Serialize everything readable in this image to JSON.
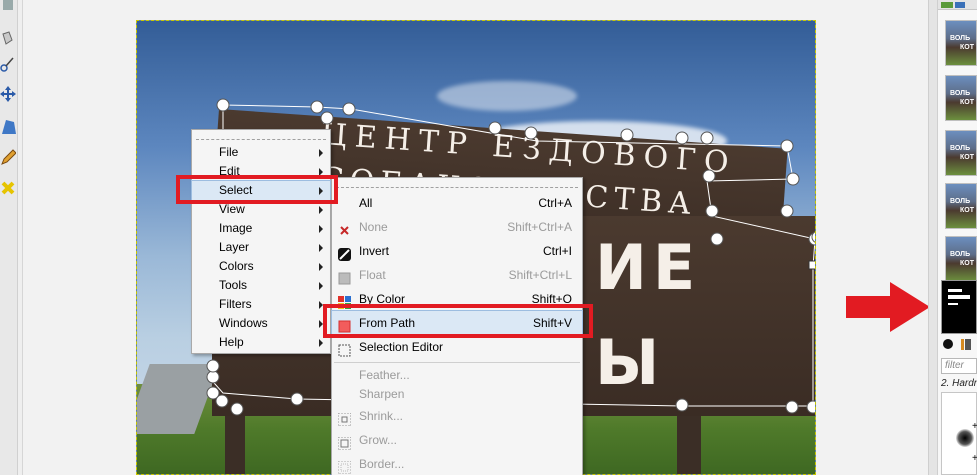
{
  "main_menu": {
    "items": [
      {
        "label": "File",
        "submenu": true
      },
      {
        "label": "Edit",
        "submenu": true
      },
      {
        "label": "Select",
        "submenu": true
      },
      {
        "label": "View",
        "submenu": true
      },
      {
        "label": "Image",
        "submenu": true
      },
      {
        "label": "Layer",
        "submenu": true
      },
      {
        "label": "Colors",
        "submenu": true
      },
      {
        "label": "Tools",
        "submenu": true
      },
      {
        "label": "Filters",
        "submenu": true
      },
      {
        "label": "Windows",
        "submenu": true
      },
      {
        "label": "Help",
        "submenu": true
      }
    ],
    "highlighted": "Select"
  },
  "select_menu": {
    "items": [
      {
        "label": "All",
        "shortcut": "Ctrl+A",
        "icon": "select-all-icon",
        "enabled": true
      },
      {
        "label": "None",
        "shortcut": "Shift+Ctrl+A",
        "icon": "select-none-icon",
        "enabled": false
      },
      {
        "label": "Invert",
        "shortcut": "Ctrl+I",
        "icon": "invert-icon",
        "enabled": true
      },
      {
        "label": "Float",
        "shortcut": "Shift+Ctrl+L",
        "icon": "float-icon",
        "enabled": false
      },
      {
        "label": "By Color",
        "shortcut": "Shift+O",
        "icon": "by-color-icon",
        "enabled": true
      },
      {
        "label": "From Path",
        "shortcut": "Shift+V",
        "icon": "from-path-icon",
        "enabled": true
      },
      {
        "label": "Selection Editor",
        "shortcut": "",
        "icon": "selection-editor-icon",
        "enabled": true
      },
      {
        "label": "Feather...",
        "shortcut": "",
        "icon": "",
        "enabled": false
      },
      {
        "label": "Sharpen",
        "shortcut": "",
        "icon": "",
        "enabled": false
      },
      {
        "label": "Shrink...",
        "shortcut": "",
        "icon": "shrink-icon",
        "enabled": false
      },
      {
        "label": "Grow...",
        "shortcut": "",
        "icon": "grow-icon",
        "enabled": false
      },
      {
        "label": "Border...",
        "shortcut": "",
        "icon": "border-icon",
        "enabled": false
      }
    ],
    "highlighted": "From Path"
  },
  "image": {
    "sign_line1": "ЦЕНТР ЕЗДОВОГО",
    "sign_line2": "СОБАКОВОДСТВА",
    "sign_big1": "ИЕ",
    "sign_big2": "Ы",
    "thumb_text1": "ВОЛЬ",
    "thumb_text2": "КОТ"
  },
  "dock": {
    "filter_placeholder": "filter",
    "brush_label": "2. Hardn"
  },
  "colors": {
    "highlight_red": "#e21b22",
    "menu_highlight": "#dbe8f5"
  }
}
